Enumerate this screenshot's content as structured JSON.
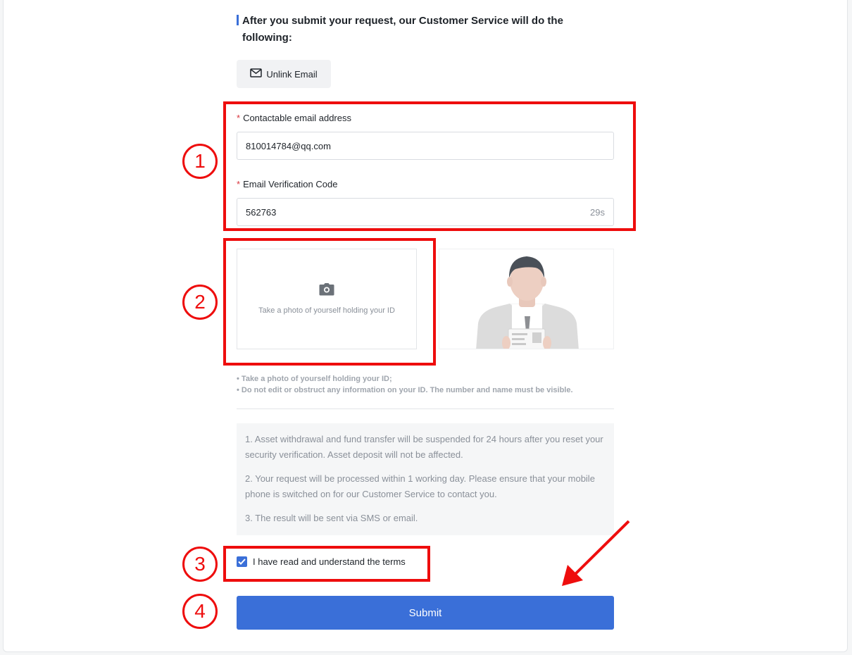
{
  "heading": "After you submit your request, our Customer Service will do the following:",
  "unlink_chip": {
    "label": "Unlink Email",
    "icon": "mail-icon"
  },
  "email_field": {
    "label": "Contactable email address",
    "required_mark": "*",
    "value": "810014784@qq.com"
  },
  "code_field": {
    "label": "Email Verification Code",
    "required_mark": "*",
    "value": "562763",
    "countdown": "29s"
  },
  "upload": {
    "label": "Take a photo of yourself holding your ID",
    "icon": "camera-icon"
  },
  "tips": [
    "Take a photo of yourself holding your ID;",
    "Do not edit or obstruct any information on your ID. The number and name must be visible."
  ],
  "notice": [
    "1. Asset withdrawal and fund transfer will be suspended for 24 hours after you reset your security verification. Asset deposit will not be affected.",
    "2. Your request will be processed within 1 working day. Please ensure that your mobile phone is switched on for our Customer Service to contact you.",
    "3. The result will be sent via SMS or email."
  ],
  "agree": {
    "label": "I have read and understand the terms",
    "checked": true
  },
  "submit_label": "Submit",
  "annotations": {
    "steps": [
      "1",
      "2",
      "3",
      "4"
    ],
    "color": "#ee0d0d"
  },
  "colors": {
    "accent": "#3a6fd8",
    "required": "#d9363e"
  }
}
